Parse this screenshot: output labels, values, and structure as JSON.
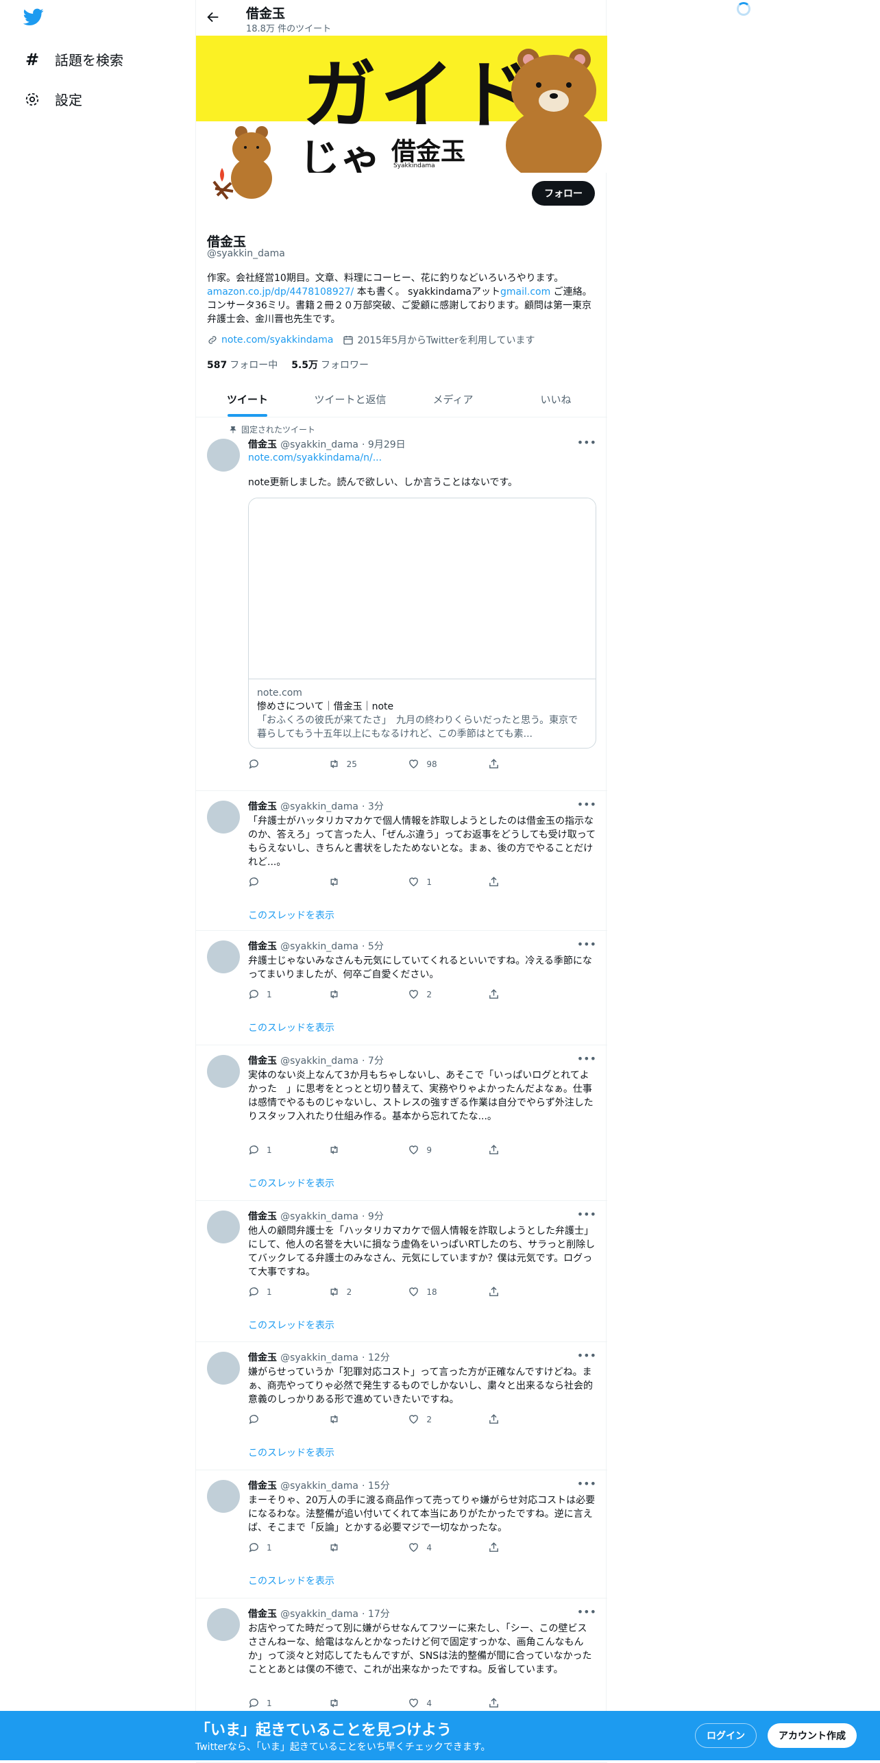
{
  "nav": {
    "explore": "話題を検索",
    "settings": "設定"
  },
  "header": {
    "title": "借金玉",
    "tweets_count": "18.8万 件のツイート"
  },
  "banner": {
    "big_word": "ガイド",
    "ja": "じゃ",
    "brand": "借金玉",
    "brand_sub": "Syakkindama"
  },
  "profile": {
    "follow": "フォロー",
    "name": "借金玉",
    "handle": "@syakkin_dama",
    "bio_1": "作家。会社経営10期目。文章、料理にコーヒー、花に釣りなどいろいろやります。",
    "bio_link": "amazon.co.jp/dp/4478108927/",
    "bio_2": " 本も書く。 syakkindamaアット",
    "bio_gmail": "gmail.com",
    "bio_3": " ご連絡。 コンサータ36ミリ。書籍２冊２０万部突破、ご愛顧に感謝しております。顧問は第一東京弁護士会、金川晋也先生です。",
    "website": "note.com/syakkindama",
    "joined": "2015年5月からTwitterを利用しています",
    "following_n": "587",
    "following_l": "フォロー中",
    "followers_n": "5.5万",
    "followers_l": "フォロワー"
  },
  "tabs": [
    "ツイート",
    "ツイートと返信",
    "メディア",
    "いいね"
  ],
  "pinned_label": "固定されたツイート",
  "pinned": {
    "name": "借金玉",
    "handle": "@syakkin_dama",
    "time": "· 9月29日",
    "link": "note.com/syakkindama/n/...",
    "text": "note更新しました。読んで欲しい、しか言うことはないです。",
    "card_domain": "note.com",
    "card_title": "惨めさについて｜借金玉｜note",
    "card_desc": "「おふくろの彼氏が来てたさ」　九月の終わりくらいだったと思う。東京で暮らしてもう十五年以上にもなるけれど、この季節はとても素...",
    "reply": "",
    "rt": "25",
    "like": "98"
  },
  "thread_label": "このスレッドを表示",
  "tweets": [
    {
      "name": "借金玉",
      "handle": "@syakkin_dama",
      "time": "· 3分",
      "text": "「弁護士がハッタリカマカケで個人情報を詐取しようとしたのは借金玉の指示なのか、答えろ」って言った人、「ぜんぶ違う」ってお返事をどうしても受け取ってもらえないし、きちんと書状をしたためないとな。まぁ、後の方でやることだけれど...。",
      "reply": "",
      "rt": "",
      "like": "1"
    },
    {
      "name": "借金玉",
      "handle": "@syakkin_dama",
      "time": "· 5分",
      "text": "弁護士じゃないみなさんも元気にしていてくれるといいですね。冷える季節になってまいりましたが、何卒ご自愛ください。",
      "reply": "1",
      "rt": "",
      "like": "2"
    },
    {
      "name": "借金玉",
      "handle": "@syakkin_dama",
      "time": "· 7分",
      "text": "実体のない炎上なんて3か月もちゃしないし、あそこで「いっぱいログとれてよかった　」に思考をとっとと切り替えて、実務やりゃよかったんだよなぁ。仕事は感情でやるものじゃないし、ストレスの強すぎる作業は自分でやらず外注したりスタッフ入れたり仕組み作る。基本から忘れてたな...。",
      "reply": "1",
      "rt": "",
      "like": "9"
    },
    {
      "name": "借金玉",
      "handle": "@syakkin_dama",
      "time": "· 9分",
      "text": "他人の顧問弁護士を「ハッタリカマカケで個人情報を詐取しようとした弁護士」にして、他人の名誉を大いに損なう虚偽をいっぱいRTしたのち、サラっと削除してバックレてる弁護士のみなさん、元気にしていますか？僕は元気です。ログって大事ですね。",
      "reply": "1",
      "rt": "2",
      "like": "18"
    },
    {
      "name": "借金玉",
      "handle": "@syakkin_dama",
      "time": "· 12分",
      "text": "嫌がらせっていうか「犯罪対応コスト」って言った方が正確なんですけどね。まぁ、商売やってりゃ必然で発生するものでしかないし、粛々と出来るなら社会的意義のしっかりある形で進めていきたいですね。",
      "reply": "",
      "rt": "",
      "like": "2"
    },
    {
      "name": "借金玉",
      "handle": "@syakkin_dama",
      "time": "· 15分",
      "text": "まーそりゃ、20万人の手に渡る商品作って売ってりゃ嫌がらせ対応コストは必要になるわな。法整備が追い付いてくれて本当にありがたかったですね。逆に言えば、そこまで「反論」とかする必要マジで一切なかったな。",
      "reply": "1",
      "rt": "",
      "like": "4"
    },
    {
      "name": "借金玉",
      "handle": "@syakkin_dama",
      "time": "· 17分",
      "text": "お店やってた時だって別に嫌がらせなんてフツーに来たし、「シー、この壁ビスささんねーな、給電はなんとかなったけど何で固定すっかな、画角こんなもんか」って淡々と対応してたもんですが、SNSは法的整備が間に合っていなかったこととあとは僕の不徳で、これが出来なかったですね。反省しています。",
      "reply": "1",
      "rt": "",
      "like": "4"
    }
  ],
  "bottom": {
    "title": "「いま」起きていることを見つけよう",
    "sub": "Twitterなら、「いま」起きていることをいち早くチェックできます。",
    "login": "ログイン",
    "signup": "アカウント作成"
  }
}
